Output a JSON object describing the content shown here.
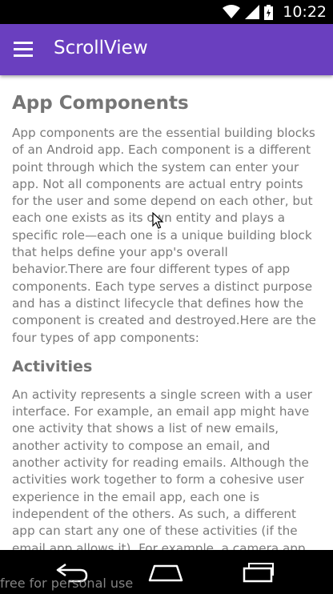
{
  "status_bar": {
    "time": "10:22",
    "icons": [
      "wifi-icon",
      "signal-icon",
      "battery-charging-icon"
    ]
  },
  "app_bar": {
    "title": "ScrollView",
    "menu_icon": "hamburger-menu-icon",
    "color": "#6a3fbf"
  },
  "content": {
    "heading": "App Components",
    "intro": "App components are the essential building blocks of an Android app. Each component is a different point through which the system can enter your app. Not all components are actual entry points for the user and some depend on each other, but each one exists as its own entity and plays a specific role—each one is a unique building block that helps define your app's overall behavior.There are four different types of app components. Each type serves a distinct purpose and has a distinct lifecycle that defines how the component is created and destroyed.Here are the four types of app components:",
    "activities_heading": "Activities",
    "activities_text": "An activity represents a single screen with a user interface. For example, an email app might have one activity that shows a list of new emails, another activity to compose an email, and another activity for reading emails. Although the activities work together to form a cohesive user experience in the email app, each one is independent of the others. As such, a different app can start any one of these activities (if the email app allows it). For example, a camera app can start the activity in the email app that composes new mail, in order for the user to share a picture.An"
  },
  "nav_bar": {
    "buttons": [
      "back-icon",
      "home-icon",
      "recents-icon"
    ]
  },
  "watermark": "free for personal use"
}
